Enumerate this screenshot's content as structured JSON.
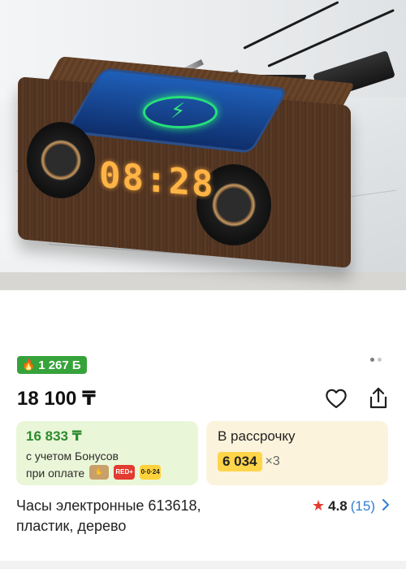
{
  "product": {
    "bonus_badge": "1 267 Б",
    "price": "18 100 ₸",
    "title_line1": "Часы электронные 613618,",
    "title_line2": "пластик, дерево",
    "image_clock_text": "08:28"
  },
  "bonus_card": {
    "price": "16 833 ₸",
    "line1": "с учетом Бонусов",
    "line2": "при оплате",
    "chips": [
      "RED+",
      "0·0·24"
    ]
  },
  "installment_card": {
    "title": "В рассрочку",
    "amount": "6 034",
    "multiplier": "×3"
  },
  "rating": {
    "value": "4.8",
    "reviews": "(15)"
  },
  "carousel": {
    "pages": 2,
    "active": 1
  },
  "colors": {
    "bonus_green": "#36a33a",
    "bonus_card_bg": "#eaf6d8",
    "install_card_bg": "#fbf3dc",
    "install_highlight": "#ffd54a",
    "star": "#e23b2f",
    "link": "#2f7fd0"
  }
}
